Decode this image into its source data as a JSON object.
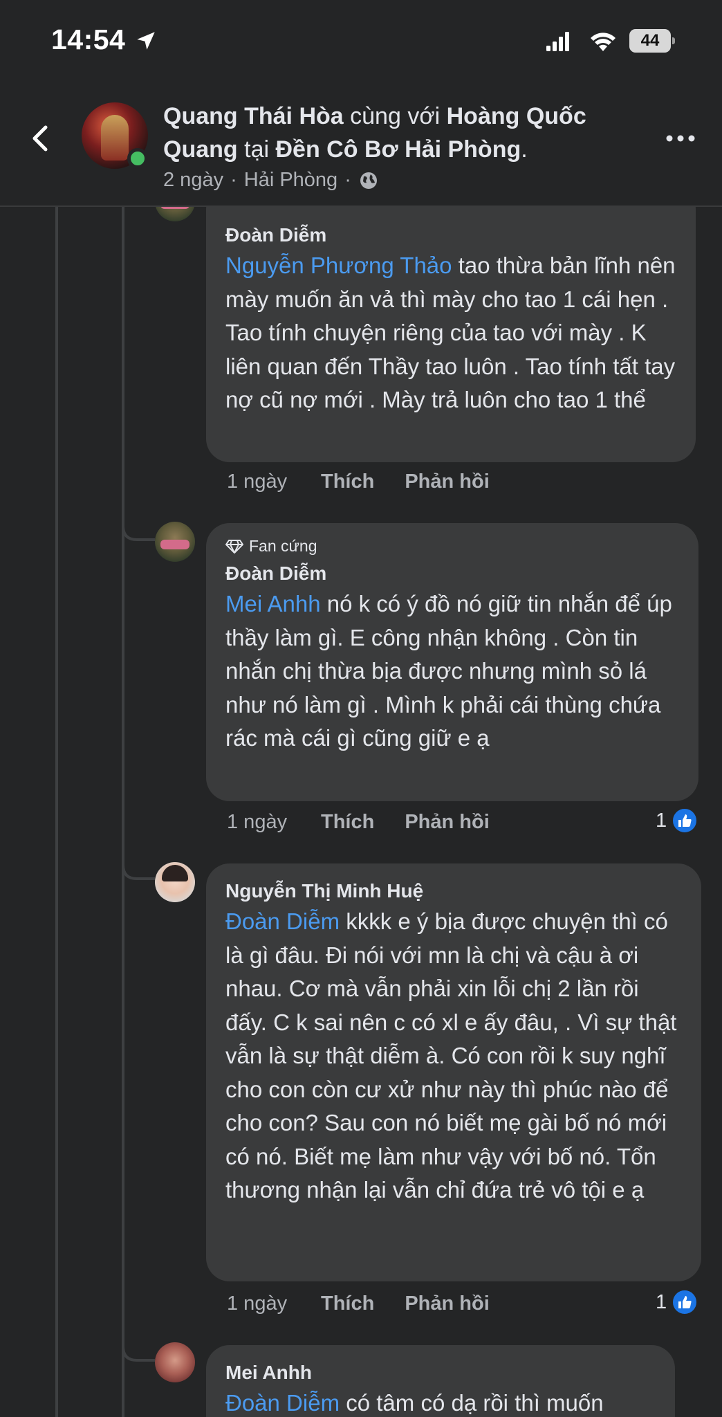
{
  "status": {
    "time": "14:54",
    "battery": "44"
  },
  "post": {
    "author": "Quang Thái Hòa",
    "with_text": "cùng với",
    "tagged": "Hoàng Quốc Quang",
    "at_text": "tại",
    "place": "Đền Cô Bơ Hải Phòng",
    "period": ".",
    "age": "2 ngày",
    "location": "Hải Phòng",
    "sep": "·"
  },
  "comments": [
    {
      "author": "Đoàn Diễm",
      "mention": "Nguyễn Phương Thảo",
      "text": " tao thừa bản lĩnh nên mày muốn ăn vả thì mày cho tao 1 cái hẹn . Tao tính chuyện riêng của tao với mày . K liên quan đến Thầy tao luôn . Tao tính tất tay nợ cũ nợ mới . Mày trả luôn cho tao 1 thể",
      "time": "1 ngày",
      "like": "Thích",
      "reply": "Phản hồi"
    },
    {
      "badge": "Fan cứng",
      "author": "Đoàn Diễm",
      "mention": "Mei Anhh",
      "text": " nó k có ý đồ nó giữ tin nhắn để úp thầy làm gì. E công nhận không . Còn tin nhắn chị thừa bịa được nhưng mình sỏ lá như nó làm gì . Mình k phải cái thùng chứa rác mà cái gì cũng giữ e ạ",
      "time": "1 ngày",
      "like": "Thích",
      "reply": "Phản hồi",
      "likes": "1"
    },
    {
      "author": "Nguyễn Thị Minh Huệ",
      "mention": "Đoàn Diễm",
      "text": " kkkk e ý bịa được chuyện thì có là gì đâu. Đi nói với mn là chị và cậu à ơi nhau. Cơ mà vẫn phải xin lỗi chị 2 lần rồi đấy. C k sai nên c có xl e ấy đâu, . Vì sự thật vẫn là sự thật diễm à. Có con rồi k suy nghĩ cho con còn cư xử như này thì phúc nào để cho con? Sau con nó biết mẹ gài bố nó mới có nó. Biết mẹ làm như vậy với bố nó. Tổn thương nhận lại vẫn chỉ đứa trẻ vô tội e ạ",
      "time": "1 ngày",
      "like": "Thích",
      "reply": "Phản hồi",
      "likes": "1"
    },
    {
      "author": "Mei Anhh",
      "mention": "Đoàn Diễm",
      "text": " có tâm có dạ rồi thì muốn"
    }
  ]
}
